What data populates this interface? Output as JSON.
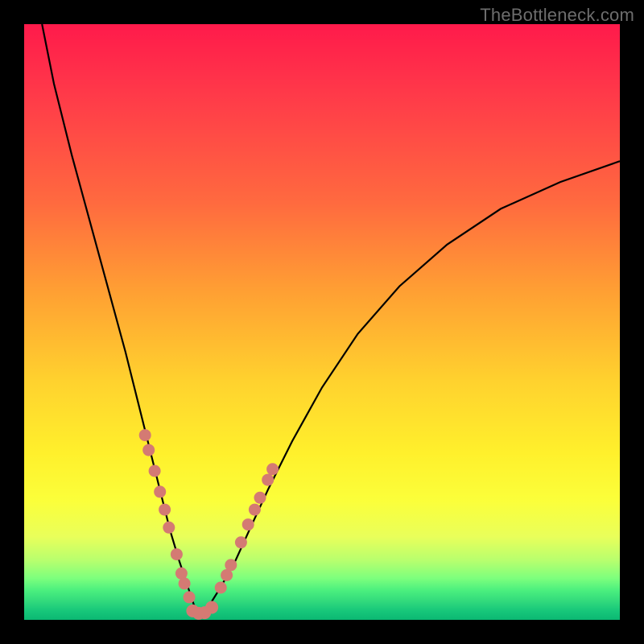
{
  "watermark": "TheBottleneck.com",
  "chart_data": {
    "type": "line",
    "title": "",
    "xlabel": "",
    "ylabel": "",
    "xlim": [
      0,
      100
    ],
    "ylim": [
      0,
      100
    ],
    "grid": false,
    "description": "V-shaped bottleneck curve on red-to-green vertical gradient; minimum near x≈29",
    "series": [
      {
        "name": "bottleneck-curve",
        "x": [
          3,
          5,
          8,
          11,
          14,
          17,
          19,
          21,
          23,
          24.5,
          26,
          27.5,
          28.5,
          29.5,
          31,
          33,
          35.5,
          38,
          41,
          45,
          50,
          56,
          63,
          71,
          80,
          90,
          100
        ],
        "y": [
          100,
          90,
          78,
          67,
          56,
          45,
          37,
          29,
          21,
          15,
          10,
          5.5,
          2.5,
          1.2,
          2.3,
          5.5,
          10,
          15.5,
          22,
          30,
          39,
          48,
          56,
          63,
          69,
          73.5,
          77
        ]
      }
    ],
    "markers_left": [
      {
        "x": 20.3,
        "y": 31
      },
      {
        "x": 20.9,
        "y": 28.5
      },
      {
        "x": 21.9,
        "y": 25
      },
      {
        "x": 22.8,
        "y": 21.5
      },
      {
        "x": 23.6,
        "y": 18.5
      },
      {
        "x": 24.3,
        "y": 15.5
      },
      {
        "x": 25.6,
        "y": 11
      },
      {
        "x": 26.4,
        "y": 7.8
      },
      {
        "x": 26.9,
        "y": 6.1
      },
      {
        "x": 27.7,
        "y": 3.8
      }
    ],
    "markers_right": [
      {
        "x": 33.0,
        "y": 5.4
      },
      {
        "x": 34.0,
        "y": 7.5
      },
      {
        "x": 34.7,
        "y": 9.2
      },
      {
        "x": 36.4,
        "y": 13.0
      },
      {
        "x": 37.6,
        "y": 16.0
      },
      {
        "x": 38.7,
        "y": 18.5
      },
      {
        "x": 39.6,
        "y": 20.5
      },
      {
        "x": 40.9,
        "y": 23.5
      },
      {
        "x": 41.7,
        "y": 25.3
      }
    ],
    "markers_bottom": [
      {
        "x": 28.3,
        "y": 1.5
      },
      {
        "x": 29.3,
        "y": 1.1
      },
      {
        "x": 30.3,
        "y": 1.2
      },
      {
        "x": 31.5,
        "y": 2.1
      }
    ],
    "background_gradient": {
      "top": "#ff1a4b",
      "mid_upper": "#ff8a38",
      "mid": "#ffe92d",
      "mid_lower": "#d7ff56",
      "bottom": "#0bb873"
    }
  }
}
